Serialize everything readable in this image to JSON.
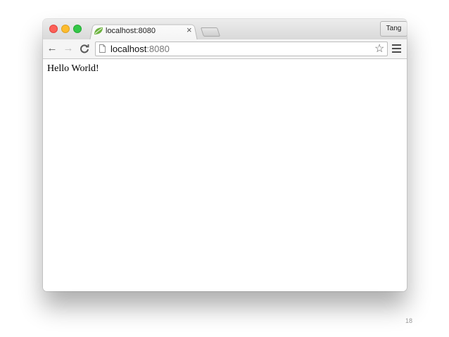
{
  "browser": {
    "tab": {
      "title": "localhost:8080",
      "close_glyph": "×",
      "favicon": "spring-leaf-icon",
      "favicon_color": "#6db33f"
    },
    "profile_label": "Tang",
    "toolbar": {
      "back_icon": "←",
      "forward_icon": "→",
      "reload_icon": "C",
      "star_icon": "☆"
    },
    "address_bar": {
      "host": "localhost",
      "port": ":8080"
    }
  },
  "page": {
    "body_text": "Hello World!"
  },
  "slide": {
    "number": "18"
  }
}
